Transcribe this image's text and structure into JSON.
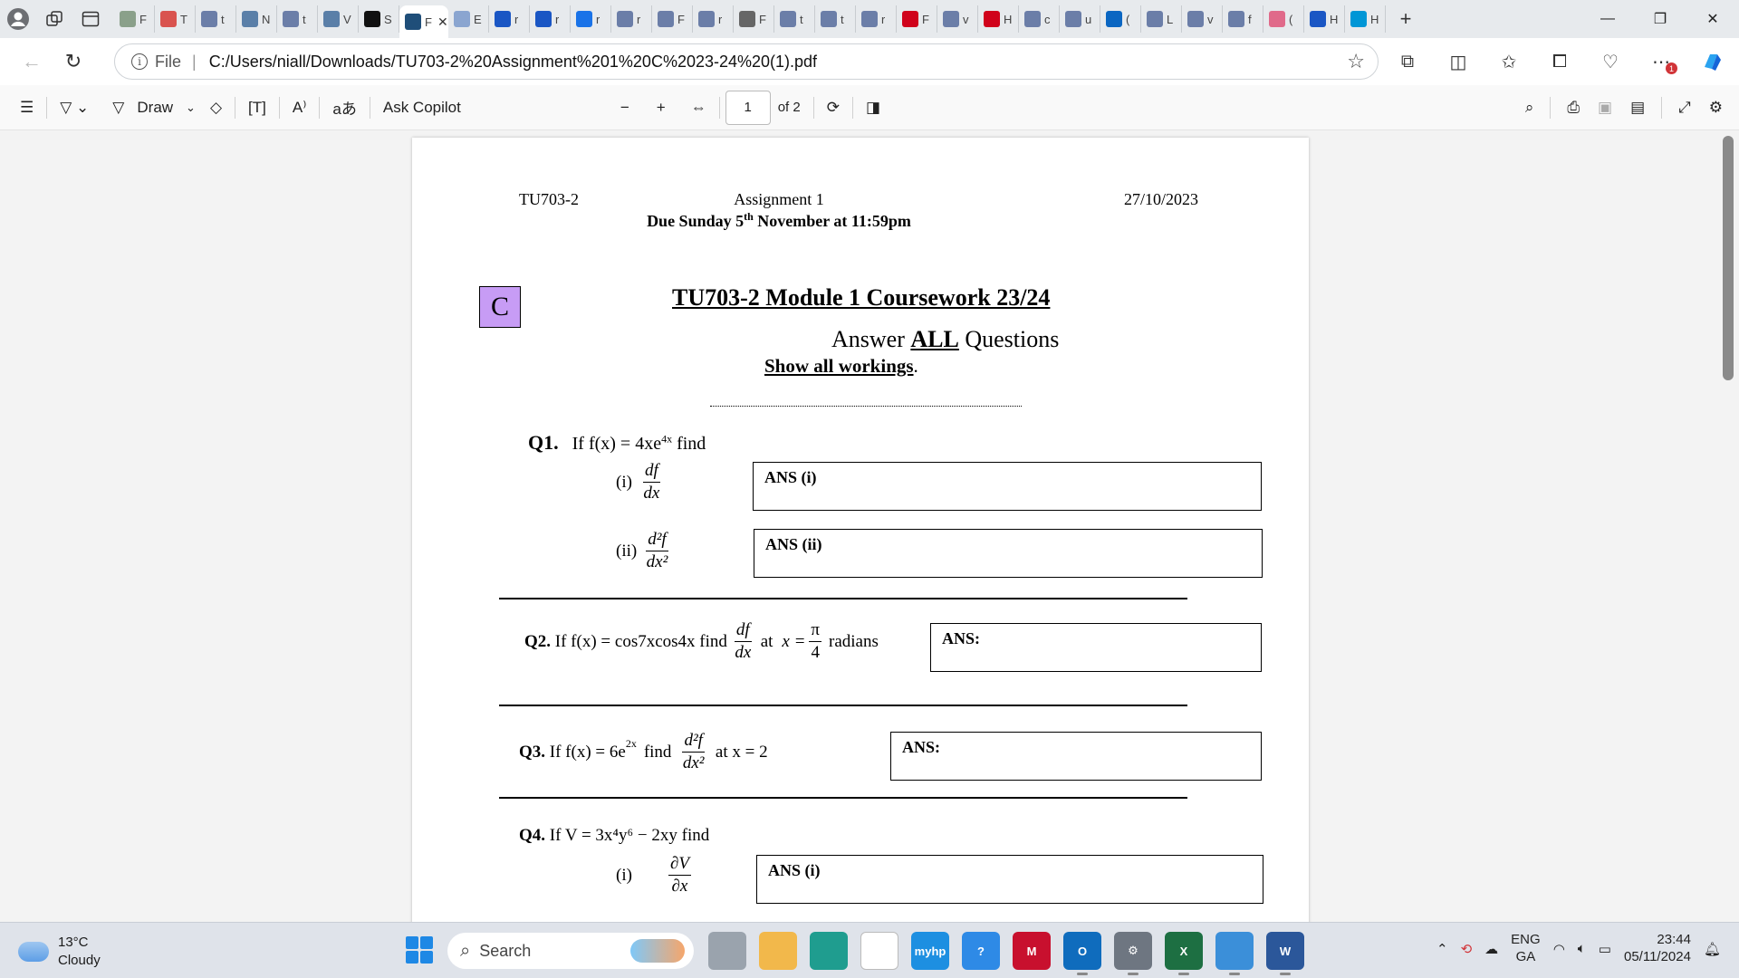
{
  "tabstrip": {
    "tabs": [
      {
        "label": "F",
        "icon": "globe-icon",
        "color": "#8aa08a"
      },
      {
        "label": "T",
        "icon": "pdf-icon",
        "color": "#d9534f"
      },
      {
        "label": "t",
        "icon": "search-icon",
        "color": "#6b7ea8"
      },
      {
        "label": "N",
        "icon": "t-logo-icon",
        "color": "#5a7fa8"
      },
      {
        "label": "t",
        "icon": "search-icon",
        "color": "#6b7ea8"
      },
      {
        "label": "V",
        "icon": "t-logo-icon",
        "color": "#5a7fa8"
      },
      {
        "label": "S",
        "icon": "d2l-icon",
        "color": "#111111"
      },
      {
        "label": "F",
        "icon": "t-logo-icon",
        "color": "#1f4e79"
      },
      {
        "label": "E",
        "icon": "word-doc-icon",
        "color": "#8aa5d0"
      },
      {
        "label": "r",
        "icon": "search-icon",
        "color": "#1a56c4"
      },
      {
        "label": "r",
        "icon": "search-icon",
        "color": "#1a56c4"
      },
      {
        "label": "r",
        "icon": "blue-circle-icon",
        "color": "#1a73e8"
      },
      {
        "label": "r",
        "icon": "search-icon",
        "color": "#6b7ea8"
      },
      {
        "label": "F",
        "icon": "shield-icon",
        "color": "#6b7ea8"
      },
      {
        "label": "r",
        "icon": "search-icon",
        "color": "#6b7ea8"
      },
      {
        "label": "F",
        "icon": "gear-circle-icon",
        "color": "#666666"
      },
      {
        "label": "t",
        "icon": "search-icon",
        "color": "#6b7ea8"
      },
      {
        "label": "t",
        "icon": "search-icon",
        "color": "#6b7ea8"
      },
      {
        "label": "r",
        "icon": "search-icon",
        "color": "#6b7ea8"
      },
      {
        "label": "F",
        "icon": "nfl-icon",
        "color": "#d0021b"
      },
      {
        "label": "v",
        "icon": "search-icon",
        "color": "#6b7ea8"
      },
      {
        "label": "H",
        "icon": "d-logo-icon",
        "color": "#d0021b"
      },
      {
        "label": "c",
        "icon": "search-icon",
        "color": "#6b7ea8"
      },
      {
        "label": "u",
        "icon": "search-icon",
        "color": "#6b7ea8"
      },
      {
        "label": "(",
        "icon": "linkedin-icon",
        "color": "#0a66c2"
      },
      {
        "label": "L",
        "icon": "search-icon",
        "color": "#6b7ea8"
      },
      {
        "label": "v",
        "icon": "search-icon",
        "color": "#6b7ea8"
      },
      {
        "label": "f",
        "icon": "search-icon",
        "color": "#6b7ea8"
      },
      {
        "label": "(",
        "icon": "notification-icon",
        "color": "#e06a8a"
      },
      {
        "label": "H",
        "icon": "search-icon",
        "color": "#1a56c4"
      },
      {
        "label": "H",
        "icon": "hp-icon",
        "color": "#0096d6"
      }
    ],
    "active_tab_index": 7
  },
  "address": {
    "scheme": "File",
    "url": "C:/Users/niall/Downloads/TU703-2%20Assignment%201%20C%2023-24%20(1).pdf"
  },
  "pdf_toolbar": {
    "draw_label": "Draw",
    "copilot_label": "Ask Copilot",
    "page_current": "1",
    "page_total": "of 2"
  },
  "document": {
    "header_left": "TU703-2",
    "header_center": "Assignment 1",
    "due_prefix": "Due Sunday 5",
    "due_sup": "th",
    "due_suffix": " November at 11:59pm",
    "header_right": "27/10/2023",
    "version_box": "C",
    "title": "TU703-2 Module 1 Coursework 23/24",
    "answer_prefix": "Answer ",
    "answer_all": "ALL",
    "answer_suffix": " Questions",
    "show_workings": "Show all workings",
    "period": ".",
    "q1_label": "Q1.",
    "q1_text": "If f(x) = 4xe",
    "q1_sup": "4x",
    "q1_find": " find",
    "q1_i": "(i)",
    "q1_ii": "(ii)",
    "q1_i_num": "df",
    "q1_i_den": "dx",
    "q1_ii_num": "d²f",
    "q1_ii_den": "dx²",
    "ans_i": "ANS (i)",
    "ans_ii": "ANS (ii)",
    "q2_label": "Q2.",
    "q2_text": "If f(x) = cos7xcos4x find",
    "q2_num": "df",
    "q2_den": "dx",
    "q2_at": "at",
    "q2_x": "x =",
    "q2_pi": "π",
    "q2_four": "4",
    "q2_radians": "radians",
    "ans": "ANS:",
    "q3_label": "Q3.",
    "q3_text": "If f(x) = 6e",
    "q3_sup": "2x",
    "q3_find": "find",
    "q3_num": "d²f",
    "q3_den": "dx²",
    "q3_at": "at x = 2",
    "q4_label": "Q4.",
    "q4_text": "If V = 3x⁴y⁶ − 2xy find",
    "q4_i": "(i)",
    "q4_num": "∂V",
    "q4_den": "∂x"
  },
  "taskbar": {
    "temperature": "13°C",
    "weather": "Cloudy",
    "search_placeholder": "Search",
    "apps": [
      {
        "name": "task-view",
        "icon": "task-view-icon",
        "color": "#9aa3ad",
        "label": ""
      },
      {
        "name": "file-explorer",
        "icon": "folder-icon",
        "color": "#f2b84b",
        "label": ""
      },
      {
        "name": "edge",
        "icon": "edge-icon",
        "color": "#1f9d8f",
        "label": "",
        "state": "active"
      },
      {
        "name": "store",
        "icon": "store-icon",
        "color": "#ffffff",
        "label": ""
      },
      {
        "name": "myhp",
        "icon": "myhp-icon",
        "color": "#1d8fe1",
        "label": "myhp"
      },
      {
        "name": "help",
        "icon": "help-icon",
        "color": "#2e8ae6",
        "label": "?"
      },
      {
        "name": "mcafee",
        "icon": "mcafee-icon",
        "color": "#c8102e",
        "label": "M"
      },
      {
        "name": "outlook",
        "icon": "outlook-icon",
        "color": "#0f6cbd",
        "label": "O",
        "state": "open"
      },
      {
        "name": "settings",
        "icon": "gear-icon",
        "color": "#6e7681",
        "label": "⚙",
        "state": "open"
      },
      {
        "name": "excel",
        "icon": "excel-icon",
        "color": "#1d6f42",
        "label": "X",
        "state": "open"
      },
      {
        "name": "photos",
        "icon": "photos-icon",
        "color": "#3b8fd9",
        "label": "",
        "state": "open"
      },
      {
        "name": "word",
        "icon": "word-icon",
        "color": "#2b579a",
        "label": "W",
        "state": "open"
      }
    ],
    "lang_top": "ENG",
    "lang_bottom": "GA",
    "time": "23:44",
    "date": "05/11/2024"
  }
}
